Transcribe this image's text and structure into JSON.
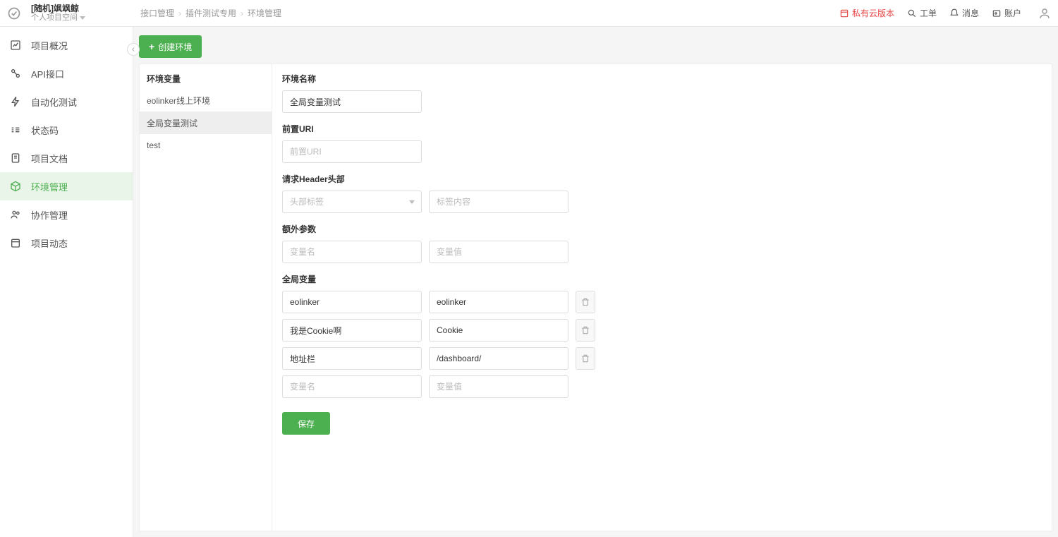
{
  "header": {
    "project_name": "[随机]飒飒鲸",
    "workspace": "个人项目空间",
    "breadcrumb": [
      "接口管理",
      "插件测试专用",
      "环境管理"
    ],
    "links": {
      "private_cloud": "私有云版本",
      "ticket": "工单",
      "message": "消息",
      "account": "账户"
    }
  },
  "sidebar": {
    "items": [
      {
        "label": "项目概况"
      },
      {
        "label": "API接口"
      },
      {
        "label": "自动化测试"
      },
      {
        "label": "状态码"
      },
      {
        "label": "项目文档"
      },
      {
        "label": "环境管理"
      },
      {
        "label": "协作管理"
      },
      {
        "label": "项目动态"
      }
    ],
    "active_index": 5
  },
  "toolbar": {
    "create_env": "创建环境"
  },
  "env_list": {
    "title": "环境变量",
    "items": [
      "eolinker线上环境",
      "全局变量测试",
      "test"
    ],
    "active_index": 1
  },
  "form": {
    "labels": {
      "env_name": "环境名称",
      "front_uri": "前置URI",
      "req_header": "请求Header头部",
      "extra_params": "额外参数",
      "global_vars": "全局变量"
    },
    "env_name_value": "全局变量测试",
    "front_uri_placeholder": "前置URI",
    "header_tag_placeholder": "头部标签",
    "header_content_placeholder": "标签内容",
    "var_name_placeholder": "变量名",
    "var_value_placeholder": "变量值",
    "global_vars_rows": [
      {
        "name": "eolinker",
        "value": "eolinker"
      },
      {
        "name": "我是Cookie啊",
        "value": "Cookie"
      },
      {
        "name": "地址栏",
        "value": "/dashboard/"
      }
    ],
    "save_label": "保存"
  }
}
